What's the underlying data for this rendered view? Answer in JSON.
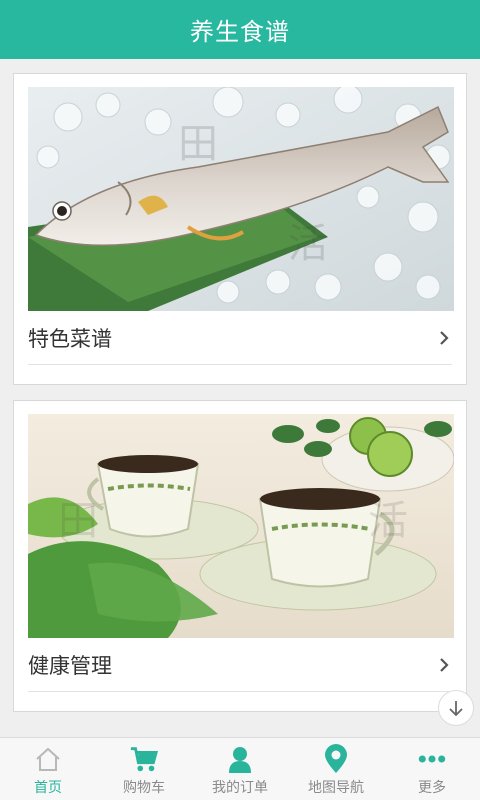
{
  "header": {
    "title": "养生食谱"
  },
  "cards": [
    {
      "label": "特色菜谱",
      "image": "fish-on-ice-photo"
    },
    {
      "label": "健康管理",
      "image": "tea-cups-photo"
    }
  ],
  "tabbar": {
    "items": [
      {
        "label": "首页",
        "icon": "home-icon",
        "active": true
      },
      {
        "label": "购物车",
        "icon": "cart-icon",
        "active": false
      },
      {
        "label": "我的订单",
        "icon": "user-icon",
        "active": false
      },
      {
        "label": "地图导航",
        "icon": "map-pin-icon",
        "active": false
      },
      {
        "label": "更多",
        "icon": "more-dots-icon",
        "active": false
      }
    ]
  },
  "colors": {
    "accent": "#28b8a0",
    "tab_active": "#2ab49c",
    "tab_inactive": "#8a8a8a"
  }
}
